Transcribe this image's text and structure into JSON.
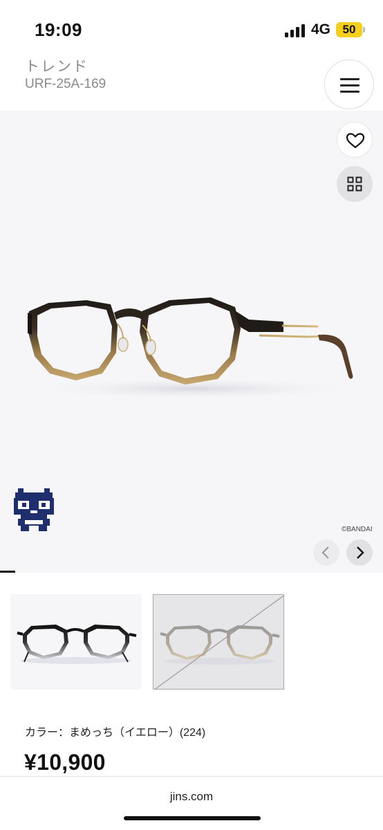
{
  "status_bar": {
    "time": "19:09",
    "network": "4G",
    "battery": "50",
    "icons": [
      "signal-icon",
      "battery-icon"
    ],
    "battery_color": "#f5cf1d"
  },
  "header": {
    "category": "トレンド",
    "model": "URF-25A-169",
    "menu_icon": "hamburger-menu-icon"
  },
  "gallery": {
    "favorite_icon": "heart-icon",
    "grid_icon": "grid-view-icon",
    "copyright": "©BANDAI",
    "prev_icon": "chevron-left-icon",
    "next_icon": "chevron-right-icon",
    "character_color": "#1f2f6e"
  },
  "thumbnails": [
    {
      "name": "black-clear-variant",
      "selected": false,
      "available": true
    },
    {
      "name": "gray-beige-variant",
      "selected": false,
      "available": false
    }
  ],
  "product": {
    "color_label": "カラー：まめっち（イエロー）(224)",
    "price": "¥10,900"
  },
  "browser": {
    "url": "jins.com"
  }
}
